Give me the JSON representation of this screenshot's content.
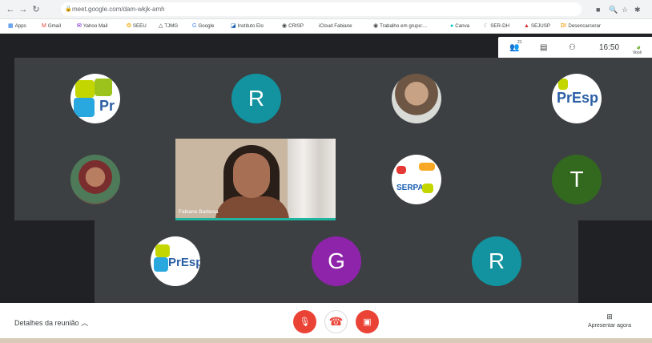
{
  "browser": {
    "url": "meet.google.com/dam-wkjk-amh",
    "bookmarks": [
      "Apps",
      "Gmail",
      "Yahoo Mail",
      "SEEU",
      "TJMG",
      "Google",
      "Instituto Elo",
      "CRISP",
      "iCloud Fabiane",
      "Trabalho em grupo:...",
      "Canva",
      "SER-DH",
      "SEJUSP",
      "Desencarcerar"
    ]
  },
  "meet": {
    "participant_count": "21",
    "clock": "16:50",
    "you_label": "Você",
    "tiles": [
      {
        "type": "logo",
        "label": "Pr"
      },
      {
        "type": "initial",
        "initial": "R",
        "color": "#12939f"
      },
      {
        "type": "photo"
      },
      {
        "type": "logo",
        "label": "PrEsp"
      },
      {
        "type": "photo"
      },
      {
        "type": "video",
        "name": "Fabiane Barbosa"
      },
      {
        "type": "logo",
        "label": "SERPA"
      },
      {
        "type": "initial",
        "initial": "T",
        "color": "#33691e"
      },
      {
        "type": "logo",
        "label": "PrEsp"
      },
      {
        "type": "initial",
        "initial": "G",
        "color": "#8e24aa"
      },
      {
        "type": "initial",
        "initial": "R",
        "color": "#12939f"
      }
    ]
  },
  "bottombar": {
    "details": "Detalhes da reunião",
    "present": "Apresentar agora"
  },
  "colors": {
    "accent_red": "#ea4335",
    "speaking_border": "#1fb69f"
  }
}
